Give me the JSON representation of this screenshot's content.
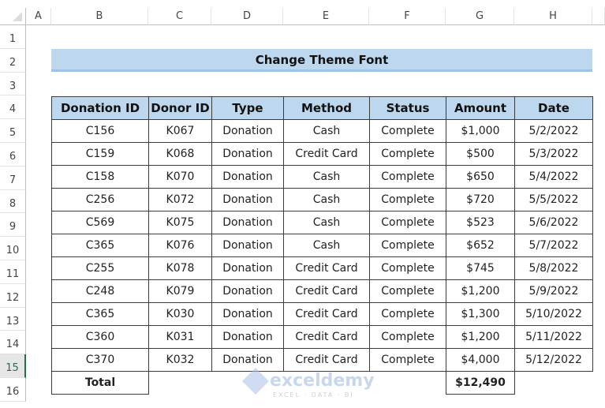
{
  "sheet": {
    "columns": [
      "A",
      "B",
      "C",
      "D",
      "E",
      "F",
      "G",
      "H"
    ],
    "rows": [
      "1",
      "2",
      "3",
      "4",
      "5",
      "6",
      "7",
      "8",
      "9",
      "10",
      "11",
      "12",
      "13",
      "14",
      "15",
      "16"
    ],
    "selected_row": "15"
  },
  "title": "Change Theme Font",
  "table": {
    "headers": [
      "Donation ID",
      "Donor ID",
      "Type",
      "Method",
      "Status",
      "Amount",
      "Date"
    ],
    "rows": [
      [
        "C156",
        "K067",
        "Donation",
        "Cash",
        "Complete",
        "$1,000",
        "5/2/2022"
      ],
      [
        "C159",
        "K068",
        "Donation",
        "Credit Card",
        "Complete",
        "$500",
        "5/3/2022"
      ],
      [
        "C158",
        "K070",
        "Donation",
        "Cash",
        "Complete",
        "$650",
        "5/4/2022"
      ],
      [
        "C256",
        "K072",
        "Donation",
        "Cash",
        "Complete",
        "$720",
        "5/5/2022"
      ],
      [
        "C569",
        "K075",
        "Donation",
        "Cash",
        "Complete",
        "$523",
        "5/6/2022"
      ],
      [
        "C365",
        "K076",
        "Donation",
        "Cash",
        "Complete",
        "$652",
        "5/7/2022"
      ],
      [
        "C255",
        "K078",
        "Donation",
        "Credit Card",
        "Complete",
        "$745",
        "5/8/2022"
      ],
      [
        "C248",
        "K079",
        "Donation",
        "Credit Card",
        "Complete",
        "$1,200",
        "5/9/2022"
      ],
      [
        "C365",
        "K030",
        "Donation",
        "Credit Card",
        "Complete",
        "$1,300",
        "5/10/2022"
      ],
      [
        "C360",
        "K031",
        "Donation",
        "Credit Card",
        "Complete",
        "$1,200",
        "5/11/2022"
      ],
      [
        "C370",
        "K032",
        "Donation",
        "Credit Card",
        "Complete",
        "$4,000",
        "5/12/2022"
      ]
    ],
    "total_label": "Total",
    "total_amount": "$12,490"
  },
  "watermark": {
    "name": "exceldemy",
    "tagline": "EXCEL · DATA · BI"
  }
}
